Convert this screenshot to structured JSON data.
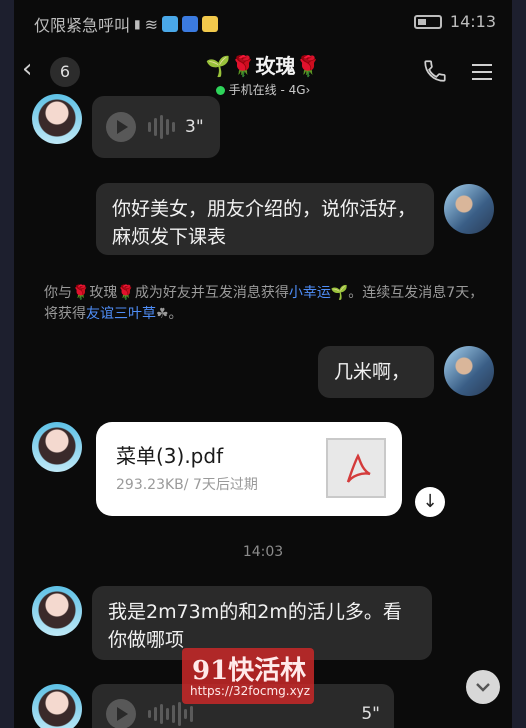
{
  "status_bar": {
    "carrier": "仅限紧急呼叫",
    "time": "14:13"
  },
  "header": {
    "unread_count": "6",
    "contact_name": "🌱🌹玫瑰🌹",
    "status": "手机在线 - 4G",
    "status_arrow": "›"
  },
  "messages": [
    {
      "side": "left",
      "type": "voice",
      "duration": "3\""
    },
    {
      "side": "right",
      "type": "text",
      "text": "你好美女，朋友介绍的，说你活好，麻烦发下课表"
    },
    {
      "type": "system",
      "parts": [
        "你与🌹玫瑰🌹成为好友并互发消息获得",
        "小幸运",
        "🌱。连续互发消息7天，将获得",
        "友谊三叶草",
        "☘。"
      ]
    },
    {
      "side": "right",
      "type": "text",
      "text": "几米啊，"
    },
    {
      "side": "left",
      "type": "file",
      "name": "菜单(3).pdf",
      "meta": "293.23KB/ 7天后过期"
    },
    {
      "type": "time",
      "text": "14:03"
    },
    {
      "side": "left",
      "type": "text",
      "text": "我是2m73m的和2m的活儿多。看你做哪项"
    },
    {
      "side": "left",
      "type": "voice",
      "duration": "5\""
    }
  ],
  "watermark": {
    "line1": "91快活林",
    "line2": "https://32focmg.xyz"
  },
  "colors": {
    "background": "#0b0b0b",
    "bubble": "#2a2a2a",
    "link": "#4f8ef7",
    "online": "#2ed45a"
  }
}
